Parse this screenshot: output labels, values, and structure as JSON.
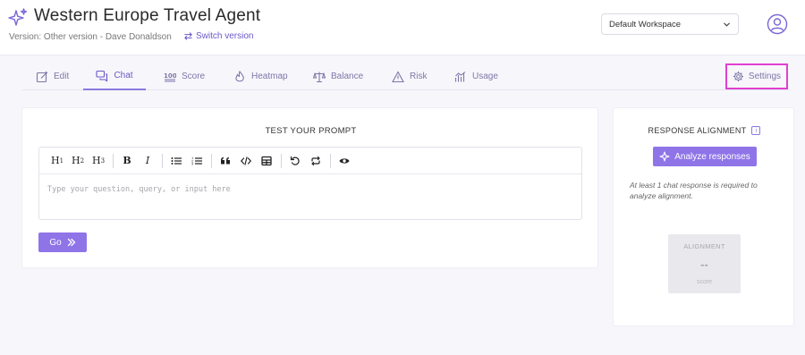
{
  "header": {
    "title": "Western Europe Travel Agent",
    "version_text": "Version: Other version - Dave Donaldson",
    "switch_label": "Switch version",
    "workspace": "Default Workspace"
  },
  "tabs": [
    {
      "label": "Edit",
      "icon": "edit-icon"
    },
    {
      "label": "Chat",
      "icon": "chat-icon",
      "active": true
    },
    {
      "label": "Score",
      "icon": "score-100-icon"
    },
    {
      "label": "Heatmap",
      "icon": "flame-icon"
    },
    {
      "label": "Balance",
      "icon": "balance-scale-icon"
    },
    {
      "label": "Risk",
      "icon": "warning-icon"
    },
    {
      "label": "Usage",
      "icon": "bar-chart-icon"
    }
  ],
  "settings_label": "Settings",
  "prompt": {
    "title": "TEST YOUR PROMPT",
    "placeholder": "Type your question, query, or input here",
    "go_label": "Go",
    "toolbar": {
      "h1": "H",
      "h2": "H",
      "h3": "H",
      "h1_sub": "1",
      "h2_sub": "2",
      "h3_sub": "3",
      "bold": "B",
      "italic": "I"
    }
  },
  "alignment": {
    "title": "RESPONSE ALIGNMENT",
    "info": "i",
    "analyze_label": "Analyze responses",
    "note": "At least 1 chat response is required to analyze alignment.",
    "score_label": "ALIGNMENT",
    "score_value": "--",
    "score_sub": "score"
  },
  "colors": {
    "accent": "#8f74e8",
    "accent_text": "#6a58c8",
    "highlight": "#e040d0"
  }
}
